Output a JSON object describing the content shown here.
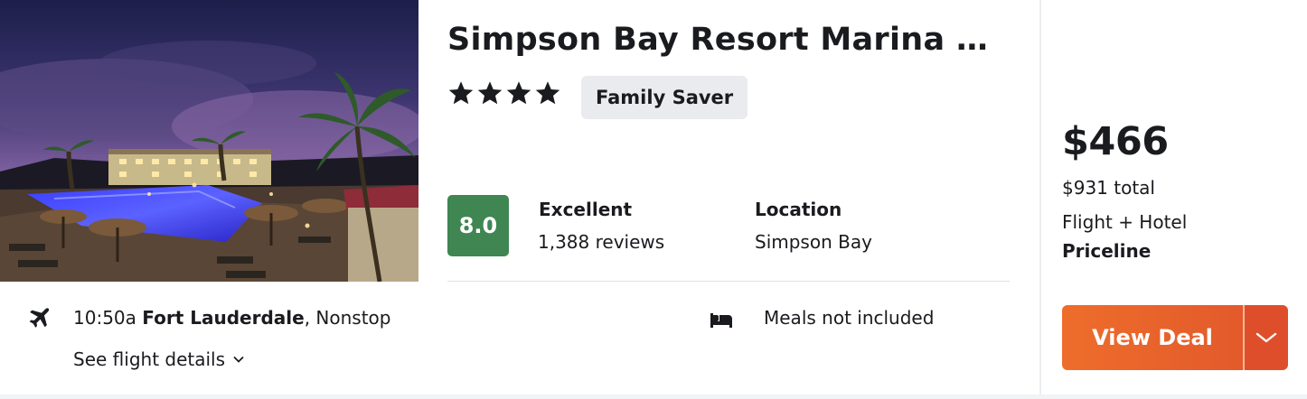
{
  "hotel": {
    "name": "Simpson Bay Resort Marina & S…",
    "stars": 4,
    "badge": "Family Saver",
    "score": "8.0",
    "score_color": "#3f8653",
    "rating_label": "Excellent",
    "reviews": "1,388 reviews",
    "location_label": "Location",
    "location_value": "Simpson Bay",
    "photo_icon": "resort-pool-night-photo"
  },
  "flight": {
    "icon": "airplane-icon",
    "time": "10:50a",
    "origin": "Fort Lauderdale",
    "stops": ", Nonstop",
    "details_link": "See flight details"
  },
  "meals": {
    "icon": "bed-icon",
    "text": "Meals not included"
  },
  "pricing": {
    "price": "$466",
    "total": "$931 total",
    "package": "Flight + Hotel",
    "provider": "Priceline",
    "cta_label": "View Deal",
    "cta_color": "#e8612b"
  }
}
